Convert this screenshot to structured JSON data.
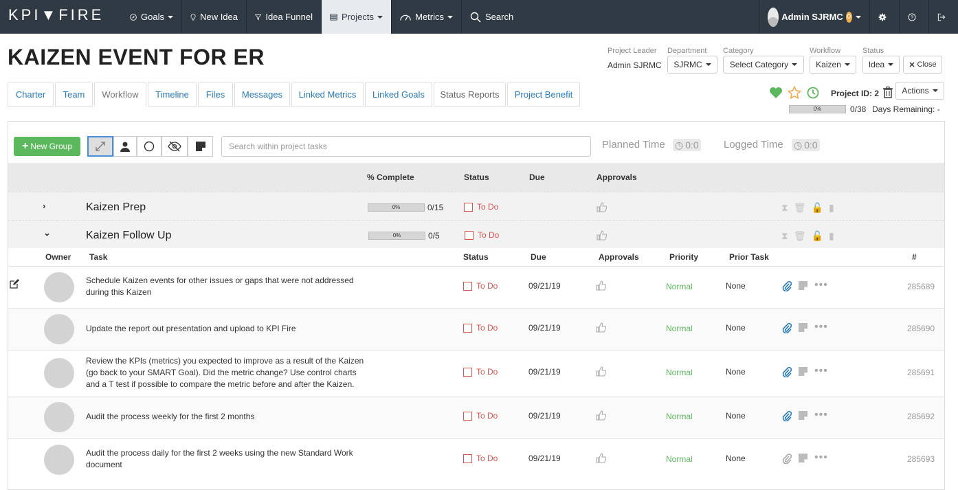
{
  "nav": {
    "logo": "KPI▼FIRE",
    "goals": "Goals",
    "new_idea": "New Idea",
    "idea_funnel": "Idea Funnel",
    "projects": "Projects",
    "metrics": "Metrics",
    "search": "Search",
    "user": "Admin SJRMC",
    "badge": "0"
  },
  "project": {
    "title": "KAIZEN EVENT FOR ER",
    "leader_label": "Project Leader",
    "leader": "Admin SJRMC",
    "department_label": "Department",
    "department": "SJRMC",
    "category_label": "Category",
    "category": "Select Category",
    "workflow_label": "Workflow",
    "workflow": "Kaizen",
    "status_label": "Status",
    "status": "Idea",
    "close": "Close",
    "actions": "Actions",
    "project_id": "Project ID: 2",
    "progress_pct": "0%",
    "progress_count": "0/38",
    "days_remaining": "Days Remaining: -"
  },
  "tabs": [
    "Charter",
    "Team",
    "Workflow",
    "Timeline",
    "Files",
    "Messages",
    "Linked Metrics",
    "Linked Goals",
    "Status Reports",
    "Project Benefit"
  ],
  "toolbar": {
    "new_group": "New Group",
    "search_placeholder": "Search within project tasks",
    "planned_label": "Planned Time",
    "planned_value": "0:0",
    "logged_label": "Logged Time",
    "logged_value": "0:0"
  },
  "group_header": {
    "complete": "% Complete",
    "status": "Status",
    "due": "Due",
    "approvals": "Approvals"
  },
  "groups": [
    {
      "name": "Kaizen Prep",
      "pct": "0%",
      "count": "0/15",
      "status": "To Do",
      "progress": 0
    },
    {
      "name": "Kaizen Follow Up",
      "pct": "0%",
      "count": "0/5",
      "status": "To Do",
      "progress": 0
    }
  ],
  "task_header": {
    "owner": "Owner",
    "task": "Task",
    "status": "Status",
    "due": "Due",
    "approvals": "Approvals",
    "priority": "Priority",
    "prior_task": "Prior Task",
    "id": "#"
  },
  "tasks": [
    {
      "text": "Schedule Kaizen events for other issues or gaps that were not addressed during this Kaizen",
      "status": "To Do",
      "due": "09/21/19",
      "priority": "Normal",
      "prior": "None",
      "id": "285689"
    },
    {
      "text": "Update the report out presentation and upload to KPI Fire",
      "status": "To Do",
      "due": "09/21/19",
      "priority": "Normal",
      "prior": "None",
      "id": "285690"
    },
    {
      "text": "Review the KPIs (metrics) you expected to improve as a result of the Kaizen (go back to your SMART Goal). Did the metric change? Use control charts and a T test if possible to compare the metric before and after the Kaizen.",
      "status": "To Do",
      "due": "09/21/19",
      "priority": "Normal",
      "prior": "None",
      "id": "285691"
    },
    {
      "text": "Audit the process weekly for the first 2 months",
      "status": "To Do",
      "due": "09/21/19",
      "priority": "Normal",
      "prior": "None",
      "id": "285692"
    },
    {
      "text": "Audit the process daily for the first 2 weeks using the new Standard Work document",
      "status": "To Do",
      "due": "09/21/19",
      "priority": "Normal",
      "prior": "None",
      "id": "285693"
    }
  ],
  "colors": {
    "nav_bg": "#2f3a45",
    "accent_green": "#5cb85c",
    "todo_red": "#d9534f",
    "link_blue": "#2a7ab9"
  }
}
